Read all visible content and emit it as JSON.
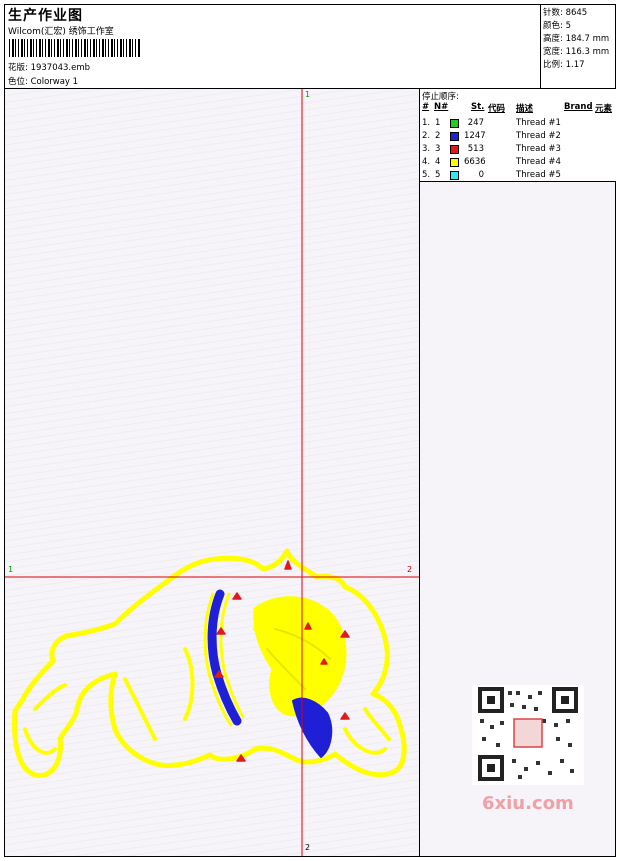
{
  "header": {
    "title": "生产作业图",
    "company": "Wilcom(汇宏) 绣饰工作室",
    "design_label": "花版:",
    "design_value": "1937043.emb",
    "colorway_label": "色位:",
    "colorway_value": "Colorway 1"
  },
  "stats": [
    {
      "label": "针数:",
      "value": "8645"
    },
    {
      "label": "颜色:",
      "value": "5"
    },
    {
      "label": "高度:",
      "value": "184.7 mm"
    },
    {
      "label": "宽度:",
      "value": "116.3 mm"
    },
    {
      "label": "比例:",
      "value": "1.17"
    }
  ],
  "stop_sequence": {
    "title": "停止顺序:",
    "columns": [
      "#",
      "N#",
      "St.",
      "代码",
      "描述",
      "Brand",
      "元素"
    ],
    "rows": [
      {
        "num": "1.",
        "n": "1",
        "color": "#22cc22",
        "st": "247",
        "desc": "Thread #1"
      },
      {
        "num": "2.",
        "n": "2",
        "color": "#1f1fd6",
        "st": "1247",
        "desc": "Thread #2"
      },
      {
        "num": "3.",
        "n": "3",
        "color": "#e01a1a",
        "st": "513",
        "desc": "Thread #3"
      },
      {
        "num": "4.",
        "n": "4",
        "color": "#ffff00",
        "st": "6636",
        "desc": "Thread #4"
      },
      {
        "num": "5.",
        "n": "5",
        "color": "#33e8f0",
        "st": "0",
        "desc": "Thread #5"
      }
    ]
  },
  "axes": {
    "top": "1",
    "bottom": "2",
    "left": "1",
    "right": "2"
  },
  "colors": {
    "crosshair": "#e00000",
    "axis_label_green": "#00a000",
    "axis_label_red": "#c00000",
    "embroidery_yellow": "#ffff00",
    "embroidery_blue": "#1f1fd6",
    "embroidery_red": "#e01a1a"
  },
  "watermark": "6xiu.com"
}
